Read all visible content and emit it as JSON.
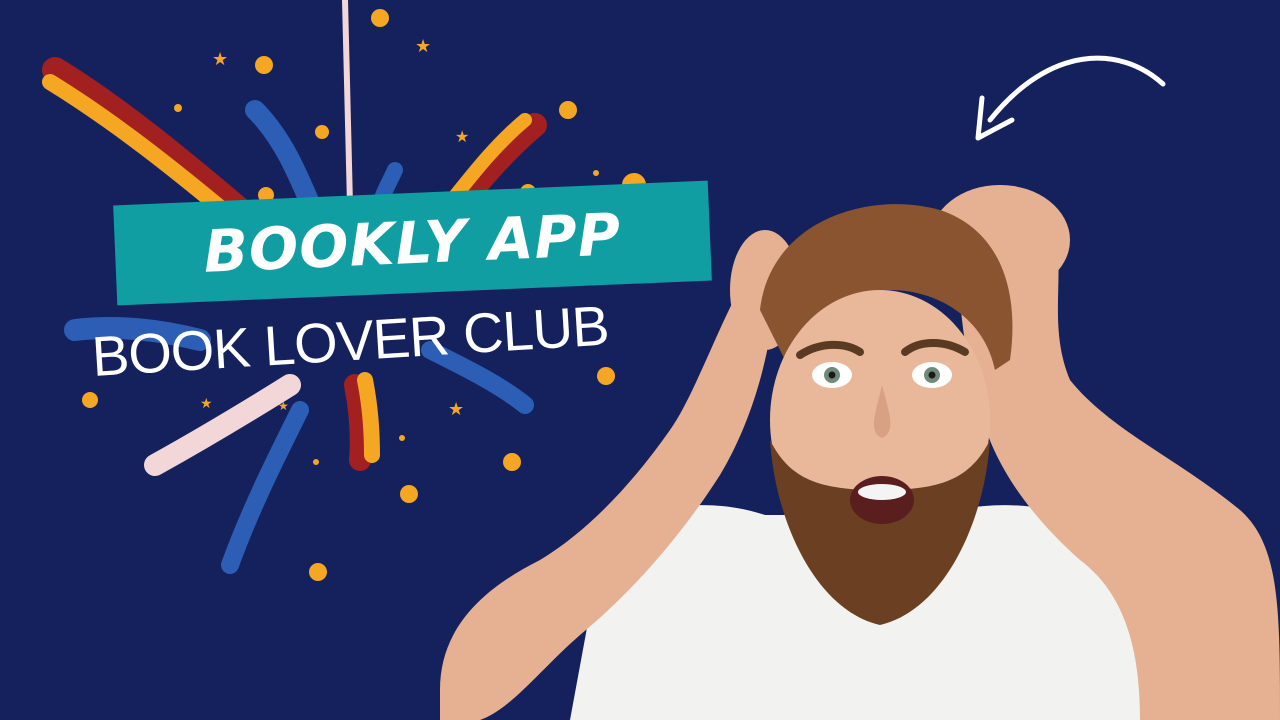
{
  "banner": {
    "title": "BOOKLY APP"
  },
  "subtitle": "BOOK LOVER CLUB",
  "decorations": {
    "burst_icon": "firework-burst",
    "arrow_icon": "curved-arrow",
    "photo_subject": "shocked-bearded-man"
  },
  "colors": {
    "background": "#15215d",
    "banner": "#119ea3",
    "gold": "#f5a623",
    "red": "#a32020",
    "blue": "#2c5eb5",
    "pink": "#f2d6d8"
  }
}
